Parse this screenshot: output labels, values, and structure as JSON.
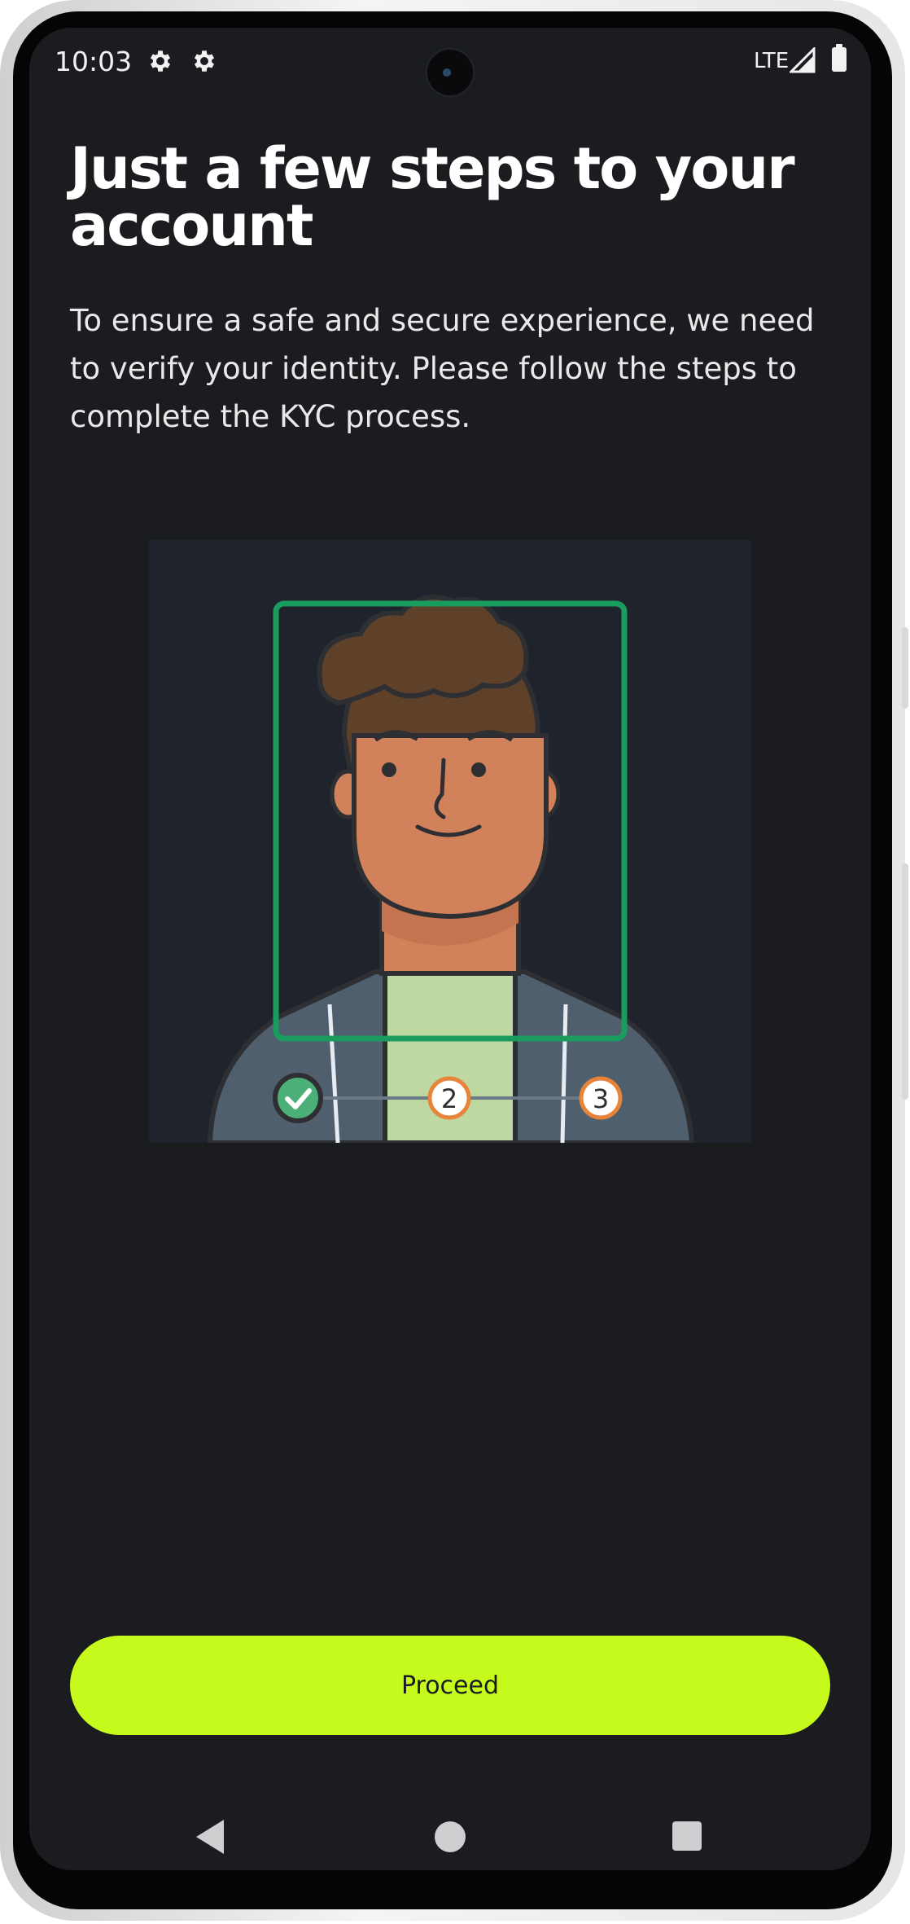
{
  "status_bar": {
    "time": "10:03",
    "icons": [
      "settings-gear-icon",
      "settings-gear-icon"
    ],
    "network": "LTE",
    "signal_icon": "cell-signal-icon",
    "battery_icon": "battery-full-icon"
  },
  "header": {
    "title": "Just a few steps to your account",
    "description": "To ensure a safe and secure experience, we need to verify your identity. Please follow the steps to complete the KYC process."
  },
  "illustration": {
    "steps": [
      {
        "label": "",
        "state": "completed",
        "icon": "check-icon"
      },
      {
        "label": "2",
        "state": "pending"
      },
      {
        "label": "3",
        "state": "pending"
      }
    ],
    "colors": {
      "frame": "#1a9c5f",
      "check": "#4caf78",
      "pending_ring": "#e8833a"
    }
  },
  "actions": {
    "proceed_label": "Proceed",
    "proceed_color": "#c6fa1c"
  },
  "nav_bar": {
    "icons": [
      "back-icon",
      "home-icon",
      "recents-icon"
    ]
  }
}
